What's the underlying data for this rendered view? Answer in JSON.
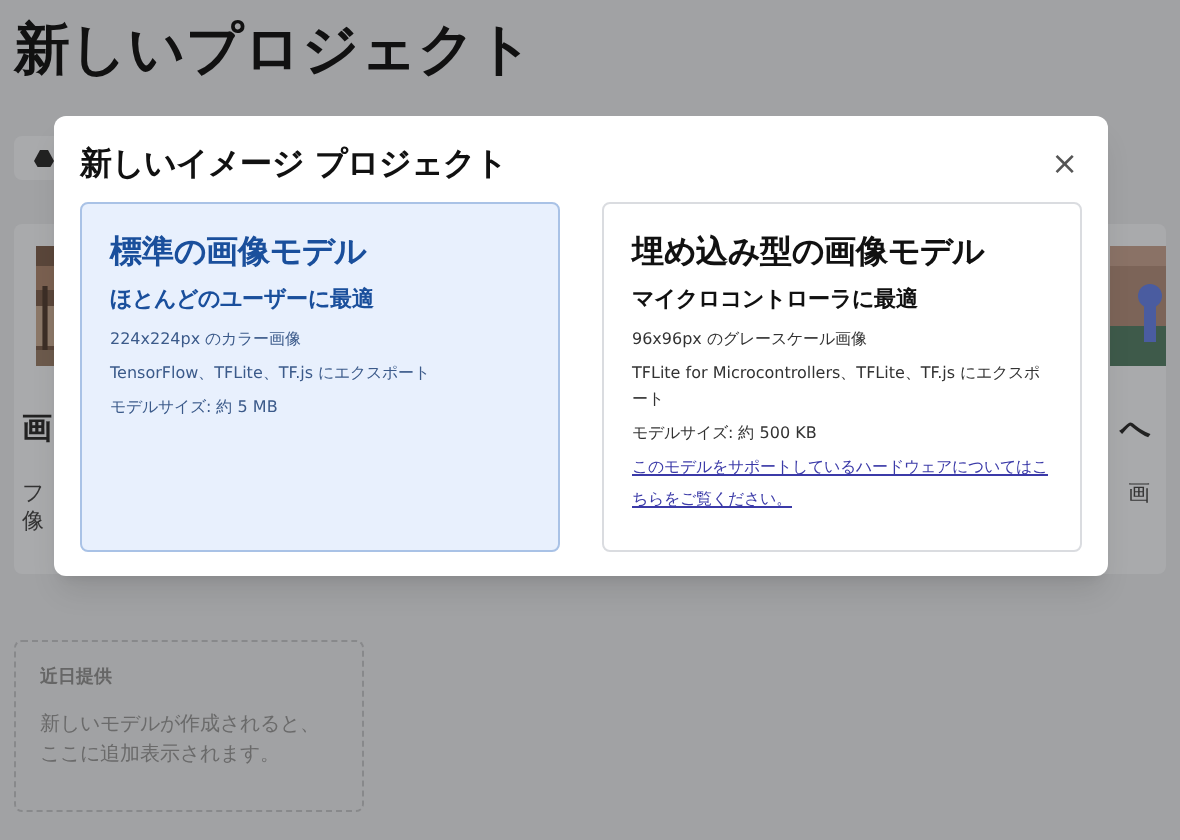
{
  "page": {
    "title": "新しいプロジェクト"
  },
  "background_cards": [
    {
      "title": "画",
      "description": [
        "フ",
        "像"
      ]
    },
    {
      "title": "へ",
      "description": [
        "画"
      ]
    }
  ],
  "coming_soon": {
    "heading": "近日提供",
    "text": "新しいモデルが作成されると、ここに追加表示されます。"
  },
  "dialog": {
    "title": "新しいイメージ プロジェクト",
    "close": "×",
    "options": [
      {
        "title": "標準の画像モデル",
        "subtitle": "ほとんどのユーザーに最適",
        "details": [
          "224x224px のカラー画像",
          "TensorFlow、TFLite、TF.js にエクスポート",
          "モデルサイズ: 約 5 MB"
        ],
        "selected": true
      },
      {
        "title": "埋め込み型の画像モデル",
        "subtitle": "マイクロコントローラに最適",
        "details": [
          "96x96px のグレースケール画像",
          "TFLite for Microcontrollers、TFLite、TF.js にエクスポート",
          "モデルサイズ: 約 500 KB"
        ],
        "link": "このモデルをサポートしているハードウェアについてはこちらをご覧ください。",
        "selected": false
      }
    ]
  }
}
